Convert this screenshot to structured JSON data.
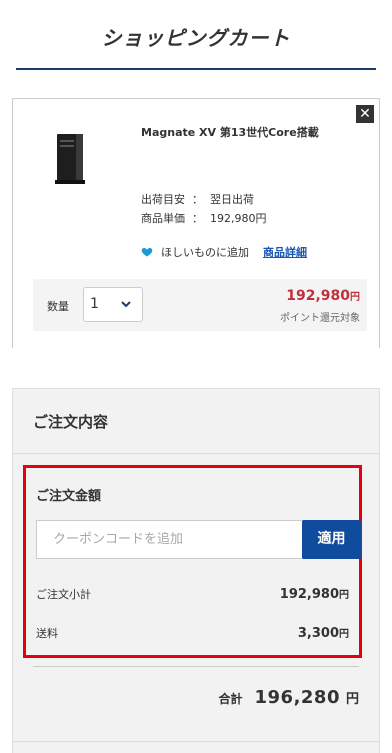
{
  "page": {
    "title": "ショッピングカート"
  },
  "cart_item": {
    "remove_glyph": "✕",
    "name": "Magnate XV 第13世代Core搭載",
    "ship_label": "出荷目安",
    "ship_value": "翌日出荷",
    "unit_price_label": "商品単価",
    "unit_price_value": "192,980円",
    "wishlist_label": "ほしいものに追加",
    "detail_link": "商品詳細",
    "quantity_label": "数量",
    "quantity_value": "1",
    "line_price": "192,980",
    "line_price_unit": "円",
    "points_note": "ポイント還元対象"
  },
  "summary": {
    "heading": "ご注文内容",
    "amount_title": "ご注文金額",
    "coupon_placeholder": "クーポンコードを追加",
    "apply_label": "適用",
    "subtotal_label": "ご注文小計",
    "subtotal_value": "192,980",
    "subtotal_unit": "円",
    "shipping_label": "送料",
    "shipping_value": "3,300",
    "shipping_unit": "円",
    "total_label": "合計",
    "total_value": "196,280",
    "total_unit": "円"
  },
  "colors": {
    "accent_blue": "#0f4c9e",
    "price_red": "#c0303a",
    "highlight_red": "#e50012",
    "heart_blue": "#1a9ad6"
  }
}
